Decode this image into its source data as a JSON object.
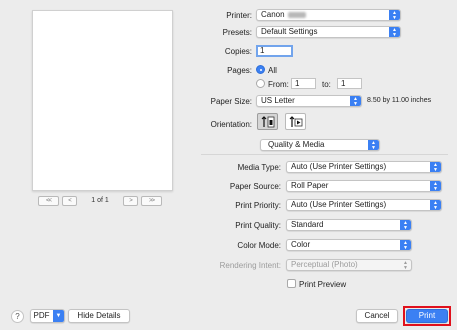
{
  "preview": {
    "page_indicator": "1 of 1",
    "nav_first": "<<",
    "nav_prev": "<",
    "nav_next": ">",
    "nav_last": ">>"
  },
  "printer": {
    "label": "Printer:",
    "value": "Canon"
  },
  "presets": {
    "label": "Presets:",
    "value": "Default Settings"
  },
  "copies": {
    "label": "Copies:",
    "value": "1"
  },
  "pages": {
    "label": "Pages:",
    "all_label": "All",
    "from_label": "From:",
    "from_value": "1",
    "to_label": "to:",
    "to_value": "1"
  },
  "paper_size": {
    "label": "Paper Size:",
    "value": "US Letter",
    "dimensions": "8.50 by 11.00 inches"
  },
  "orientation": {
    "label": "Orientation:"
  },
  "section_popup": {
    "value": "Quality & Media"
  },
  "media_type": {
    "label": "Media Type:",
    "value": "Auto (Use Printer Settings)"
  },
  "paper_source": {
    "label": "Paper Source:",
    "value": "Roll Paper"
  },
  "print_priority": {
    "label": "Print Priority:",
    "value": "Auto (Use Printer Settings)"
  },
  "print_quality": {
    "label": "Print Quality:",
    "value": "Standard"
  },
  "color_mode": {
    "label": "Color Mode:",
    "value": "Color"
  },
  "rendering_intent": {
    "label": "Rendering Intent:",
    "value": "Perceptual (Photo)"
  },
  "print_preview": {
    "label": "Print Preview"
  },
  "footer": {
    "help": "?",
    "pdf": "PDF",
    "hide_details": "Hide Details",
    "cancel": "Cancel",
    "print": "Print"
  },
  "colors": {
    "accent": "#3b80f3",
    "highlight": "#e0101c"
  },
  "icons": {
    "stepper": "up-down-chevron-icon",
    "pdf_menu": "chevron-down-icon",
    "portrait": "portrait-orientation-icon",
    "landscape": "landscape-orientation-icon"
  }
}
